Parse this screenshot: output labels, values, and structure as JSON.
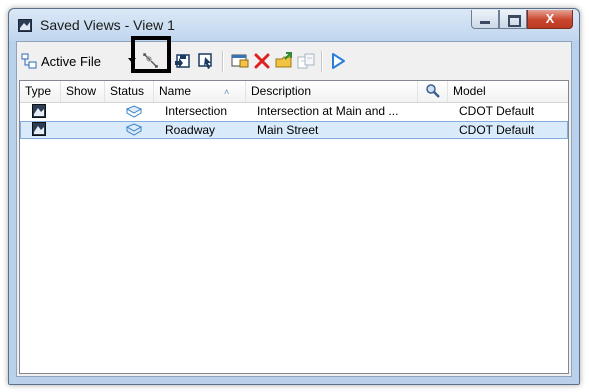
{
  "window": {
    "title": "Saved Views - View 1",
    "close_glyph": "X"
  },
  "toolbar": {
    "active_file_label": "Active File",
    "icons": [
      "active-file-icon",
      "dropdown-arrow",
      "fit-view-icon",
      "save-view-icon",
      "apply-view-icon",
      "properties-icon",
      "delete-icon",
      "import-icon",
      "export-icon",
      "play-icon"
    ],
    "delete_color": "#e02020"
  },
  "list": {
    "columns": [
      "Type",
      "Show",
      "Status",
      "Name",
      "Description",
      "",
      "Model"
    ],
    "rows": [
      {
        "name": "Intersection",
        "description": "Intersection at Main and ...",
        "model": "CDOT Default",
        "selected": false
      },
      {
        "name": "Roadway",
        "description": "Main Street",
        "model": "CDOT Default",
        "selected": true
      }
    ]
  }
}
